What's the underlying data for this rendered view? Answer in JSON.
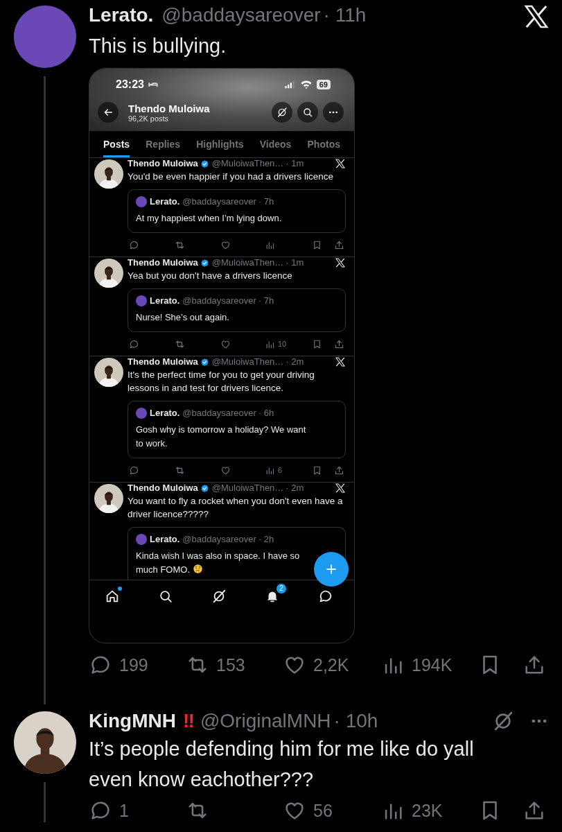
{
  "thread": [
    {
      "avatar": {
        "kind": "solid"
      },
      "author": "Lerato.",
      "handle": "@baddaysareover",
      "time": "· 11h",
      "text": "This is bullying.",
      "x_logo": true,
      "thread_below": true,
      "embedded_screenshot": {
        "status_time": "23:23",
        "battery": "69",
        "profile_name": "Thendo Muloiwa",
        "post_count": "96,2K posts",
        "tabs": [
          {
            "label": "Posts",
            "selected": true
          },
          {
            "label": "Replies",
            "selected": false
          },
          {
            "label": "Highlights",
            "selected": false
          },
          {
            "label": "Videos",
            "selected": false
          },
          {
            "label": "Photos",
            "selected": false
          }
        ],
        "posts": [
          {
            "author": "Thendo Muloiwa",
            "verified": true,
            "handle": "@MuloiwaThen…",
            "time": "· 1m",
            "text": "You'd be even happier if you had a drivers licence",
            "quote": {
              "author": "Lerato.",
              "handle": "@baddaysareover",
              "time": "· 7h",
              "text": "At my happiest when I’m lying down."
            },
            "action_bar": true
          },
          {
            "author": "Thendo Muloiwa",
            "verified": true,
            "handle": "@MuloiwaThen…",
            "time": "· 1m",
            "text": "Yea but you don't have a drivers licence",
            "quote": {
              "author": "Lerato.",
              "handle": "@baddaysareover",
              "time": "· 7h",
              "text": "Nurse! She’s out again."
            },
            "action_bar": true,
            "views": "10"
          },
          {
            "author": "Thendo Muloiwa",
            "verified": true,
            "handle": "@MuloiwaThen…",
            "time": "· 2m",
            "text": "It's the perfect time for you to get your driving lessons in and test for drivers licence.",
            "quote": {
              "author": "Lerato.",
              "handle": "@baddaysareover",
              "time": "· 6h",
              "text": "Gosh why is tomorrow a holiday? We want to work."
            },
            "action_bar": true,
            "views": "6"
          },
          {
            "author": "Thendo Muloiwa",
            "verified": true,
            "handle": "@MuloiwaThen…",
            "time": "· 2m",
            "text": "You want to fly a rocket when you don't even have a driver licence?????",
            "quote": {
              "author": "Lerato.",
              "handle": "@baddaysareover",
              "time": "· 2h",
              "text": "Kinda wish I was also in space. I have so much FOMO.",
              "frown_emoji": true
            }
          }
        ],
        "notification_count": "2",
        "home_unread": true
      },
      "actions": [
        {
          "kind": "reply",
          "count": "199"
        },
        {
          "kind": "repost",
          "count": "153"
        },
        {
          "kind": "like",
          "count": "2,2K"
        },
        {
          "kind": "views",
          "count": "194K"
        },
        {
          "kind": "bookmark"
        },
        {
          "kind": "share"
        }
      ]
    },
    {
      "author": "KingMNH",
      "badge": "‼",
      "handle": "@OriginalMNH",
      "time": "· 10h",
      "text": "It’s people defending him for me like do yall even know eachother???",
      "grok_button": true,
      "more_button": true,
      "thread_below": true,
      "actions": [
        {
          "kind": "reply",
          "count": "1"
        },
        {
          "kind": "repost"
        },
        {
          "kind": "like",
          "count": "56"
        },
        {
          "kind": "views",
          "count": "23K"
        },
        {
          "kind": "bookmark"
        },
        {
          "kind": "share"
        }
      ]
    }
  ]
}
